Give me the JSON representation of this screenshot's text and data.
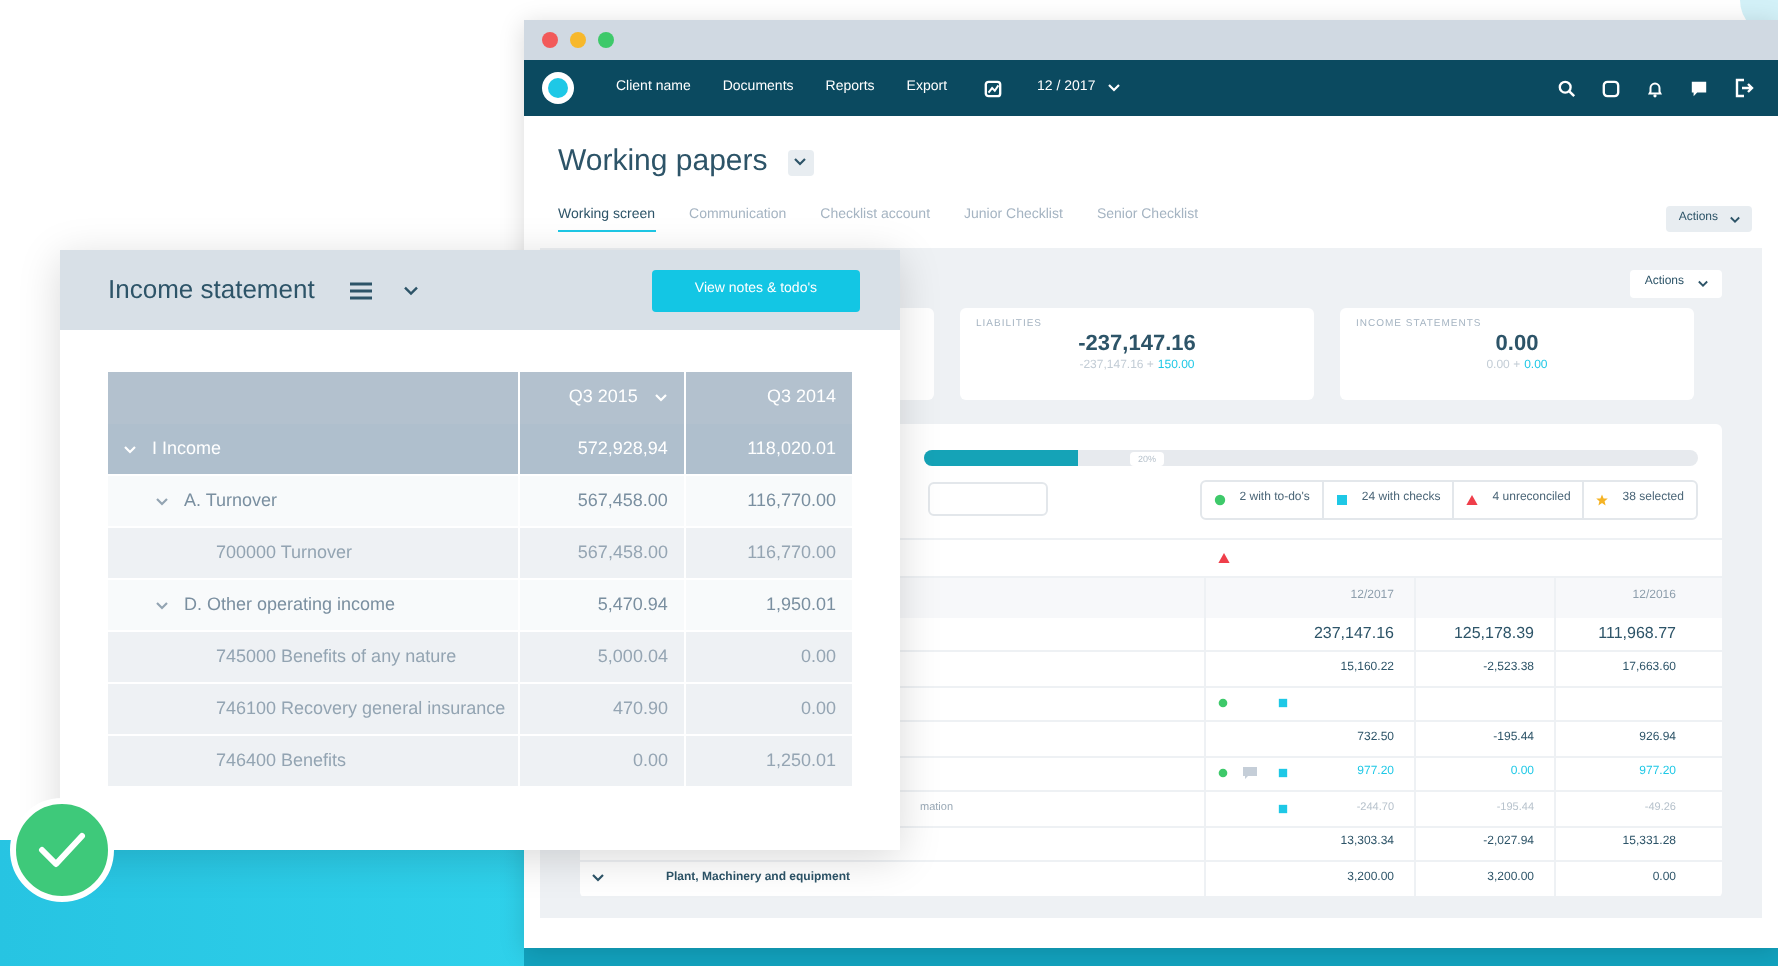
{
  "back_window": {
    "nav": {
      "items": [
        "Client name",
        "Documents",
        "Reports",
        "Export"
      ],
      "period": "12 / 2017"
    },
    "title": "Working papers",
    "tabs": [
      {
        "label": "Working screen",
        "selected": true
      },
      {
        "label": "Communication",
        "selected": false
      },
      {
        "label": "Checklist account",
        "selected": false
      },
      {
        "label": "Junior Checklist",
        "selected": false
      },
      {
        "label": "Senior Checklist",
        "selected": false
      }
    ],
    "tabs_action": "Actions",
    "panel_action": "Actions",
    "cards": [
      {
        "label": "LIABILITIES",
        "value": "-237,147.16",
        "base": "-237,147.16 +",
        "delta": "150.00"
      },
      {
        "label": "INCOME STATEMENTS",
        "value": "0.00",
        "base": "0.00 +",
        "delta": "0.00"
      }
    ],
    "progress": {
      "level": 0.2,
      "label": "20%"
    },
    "legend": [
      {
        "kind": "dot",
        "label": "2 with to-do's"
      },
      {
        "kind": "square",
        "label": "24 with checks"
      },
      {
        "kind": "triangle",
        "label": "4 unreconciled"
      },
      {
        "kind": "star",
        "label": "38 selected"
      }
    ],
    "table": {
      "columns": [
        "12/2017",
        null,
        "12/2016"
      ],
      "rows": [
        {
          "kind": "total",
          "values": [
            "237,147.16",
            "125,178.39",
            "111,968.77"
          ]
        },
        {
          "kind": "normal",
          "values": [
            "15,160.22",
            "-2,523.38",
            "17,663.60"
          ]
        },
        {
          "kind": "normal",
          "todo": true,
          "comment": false,
          "check": true
        },
        {
          "kind": "normal",
          "values": [
            "732.50",
            "-195.44",
            "926.94"
          ]
        },
        {
          "kind": "linked",
          "todo": true,
          "comment": true,
          "check": true,
          "values": [
            "977.20",
            "0.00",
            "977.20"
          ]
        },
        {
          "kind": "muted",
          "label": "mation",
          "todo": false,
          "comment": false,
          "check": true,
          "values": [
            "-244.70",
            "-195.44",
            "-49.26"
          ]
        },
        {
          "kind": "normal",
          "values": [
            "13,303.34",
            "-2,027.94",
            "15,331.28"
          ]
        },
        {
          "kind": "normal",
          "label": "Plant, Machinery and equipment",
          "expanded": true,
          "values": [
            "3,200.00",
            "3,200.00",
            "0.00"
          ]
        }
      ]
    }
  },
  "income_card": {
    "title": "Income statement",
    "button": "View notes & todo's",
    "columns": [
      "Q3 2015",
      "Q3 2014"
    ],
    "rows": [
      {
        "label": "I Income",
        "values": [
          "572,928,94",
          "118,020.01"
        ],
        "selected": true,
        "expanded": true,
        "children": [
          {
            "label": "A. Turnover",
            "values": [
              "567,458.00",
              "116,770.00"
            ],
            "selected": false,
            "expanded": true,
            "children": [
              {
                "label": "700000 Turnover",
                "values": [
                  "567,458.00",
                  "116,770.00"
                ],
                "selected": false
              }
            ]
          },
          {
            "label": "D. Other operating income",
            "values": [
              "5,470.94",
              "1,950.01"
            ],
            "selected": false,
            "expanded": true,
            "children": [
              {
                "label": "745000 Benefits of any nature",
                "values": [
                  "5,000.04",
                  "0.00"
                ],
                "selected": false
              },
              {
                "label": "746100 Recovery general insurance",
                "values": [
                  "470.90",
                  "0.00"
                ],
                "selected": false
              },
              {
                "label": "746400 Benefits",
                "values": [
                  "0.00",
                  "1,250.01"
                ],
                "selected": false
              }
            ]
          }
        ]
      }
    ]
  }
}
